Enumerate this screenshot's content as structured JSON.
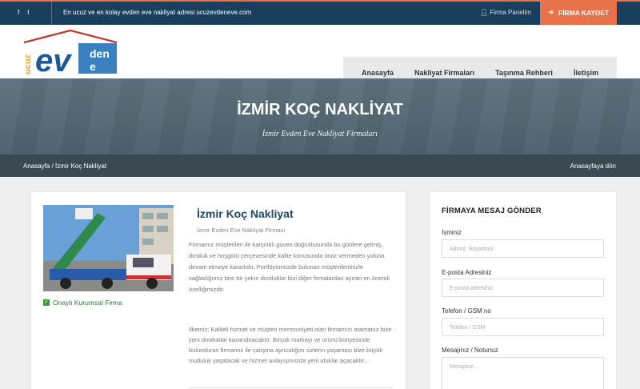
{
  "topbar": {
    "social": [
      "f",
      "t"
    ],
    "tagline": "En ucuz ve en kolay evden eve nakliyat adresi ucuzevdeneve.com",
    "panel": "Firma Panelim",
    "register": "FİRMA KAYDET"
  },
  "logo": {
    "left": "ucuz",
    "main": "ev",
    "right1": "den",
    "right2": "e"
  },
  "nav": [
    "Anasayfa",
    "Nakliyat Firmaları",
    "Taşınma Rehberi",
    "İletişim"
  ],
  "hero": {
    "title": "İZMİR KOÇ NAKLİYAT",
    "subtitle": "İzmir Evden Eve Nakliyat Firmaları"
  },
  "breadcrumb": {
    "path": "Anasayfa / İzmir Koç Nakliyat",
    "back": "Anasayfaya dön"
  },
  "firm": {
    "name": "İzmir Koç Nakliyat",
    "category": "İzmir Evden Eve Nakliyat Firması",
    "approved": "Onaylı Kurumsal Firma",
    "desc1": "Firmamız müşterileri ile karşılıklı güven doğrultusunda bu günlere gelmiş, dostluk ve hoşgörü çerçevesinde kalite konusunda taviz vermeden yoluna devam etmeye kararlıdır. Portföyümüzde bulunan müşterilerimizle sağladığımız bire bir yakın dostluklar bizi diğer firmalardan ayıran en önemli özelliğimizdir.",
    "desc2": "İlkemiz; Kaliteli hizmet ve müşteri memnuniyeti olan firmamızı aramanız bize yeni dostluklar kazandıracaktır. Birçok markayı ve ürünü bünyesinde bulunduran firmamız ile çalışma ayrıcalığını sizlerin yaşaması bize büyük mutluluk yaşatacak ve hizmet anlayışımızda yeni ufuklar açacaktır..."
  },
  "form": {
    "title": "FİRMAYA MESAJ GÖNDER",
    "name_label": "İsminiz",
    "name_ph": "Adınız, Soyadınız",
    "email_label": "E-posta Adresiniz",
    "email_ph": "E-posta adresiniz",
    "phone_label": "Telefon / GSM no",
    "phone_ph": "Telefon / GSM",
    "msg_label": "Mesajınız / Notunuz",
    "msg_ph": "Mesajınız..."
  },
  "colors": {
    "topbar": "#1a3f5c",
    "accent": "#e8734a",
    "title": "#1e4a6a",
    "approved": "#2f7d32"
  }
}
